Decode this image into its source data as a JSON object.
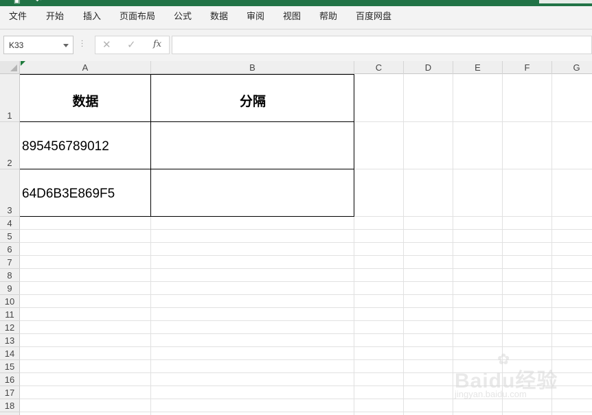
{
  "ribbon": {
    "tabs": [
      "文件",
      "开始",
      "插入",
      "页面布局",
      "公式",
      "数据",
      "审阅",
      "视图",
      "帮助",
      "百度网盘"
    ]
  },
  "formula_bar": {
    "name_box": "K33",
    "cancel_glyph": "✕",
    "enter_glyph": "✓",
    "fx_label": "fx",
    "formula_value": ""
  },
  "sheet": {
    "columns": [
      "A",
      "B",
      "C",
      "D",
      "E",
      "F",
      "G"
    ],
    "rows": [
      "1",
      "2",
      "3",
      "4",
      "5",
      "6",
      "7",
      "8",
      "9",
      "10",
      "11",
      "12",
      "13",
      "14",
      "15",
      "16",
      "17",
      "18"
    ],
    "cells": {
      "A1": "数据",
      "B1": "分隔",
      "A2": "895456789012",
      "A3": "64D6B3E869F5"
    }
  },
  "watermark": {
    "brand": "Baidu经验",
    "url": "jingyan.baidu.com"
  },
  "icons": [
    "excel-logo-icon",
    "undo-icon",
    "name-box-dropdown-icon",
    "more-options-icon",
    "cancel-icon",
    "enter-icon",
    "fx-icon",
    "select-all-icon",
    "number-as-text-indicator-icon",
    "baidu-paw-icon"
  ],
  "colors": {
    "title_bar": "#217346",
    "grid_line": "#e1e1e1",
    "cell_border": "#000000"
  }
}
